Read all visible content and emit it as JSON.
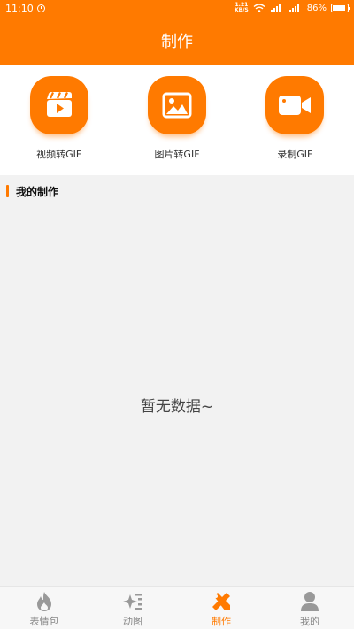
{
  "status_bar": {
    "time": "11:10",
    "network_speed_top": "1.21",
    "network_speed_bottom": "KB/S",
    "battery_percent": "86%",
    "battery_level": 0.86
  },
  "header": {
    "title": "制作"
  },
  "tools": [
    {
      "label": "视频转GIF",
      "icon": "video-clapper-icon"
    },
    {
      "label": "图片转GIF",
      "icon": "image-icon"
    },
    {
      "label": "录制GIF",
      "icon": "camera-record-icon"
    }
  ],
  "section": {
    "title": "我的制作"
  },
  "empty_state": {
    "text": "暂无数据~"
  },
  "tabbar": {
    "items": [
      {
        "label": "表情包",
        "icon": "flame-icon",
        "active": false
      },
      {
        "label": "动图",
        "icon": "sparkle-icon",
        "active": false
      },
      {
        "label": "制作",
        "icon": "make-tools-icon",
        "active": true
      },
      {
        "label": "我的",
        "icon": "person-icon",
        "active": false
      }
    ]
  },
  "colors": {
    "accent": "#ff7a00",
    "background": "#f2f2f2",
    "inactive_tab": "#888888"
  }
}
